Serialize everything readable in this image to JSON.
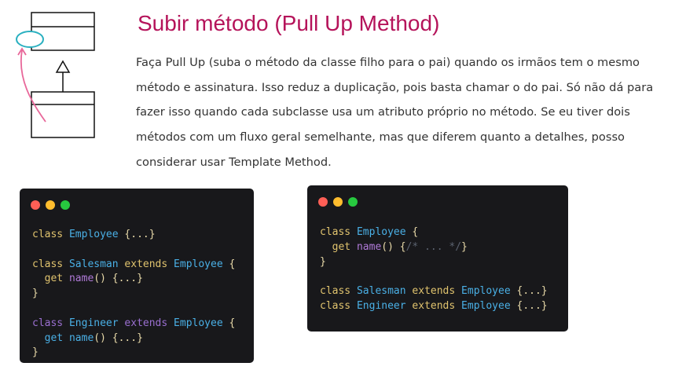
{
  "title": "Subir método (Pull Up Method)",
  "description": "Faça Pull Up (suba o método da classe filho para o pai) quando os irmãos tem o mesmo método e assinatura.  Isso reduz a duplicação, pois basta chamar o do pai. Só não dá para fazer isso quando cada subclasse usa um atributo próprio no método. Se eu tiver dois métodos com um fluxo geral semelhante, mas que diferem quanto a detalhes, posso considerar usar Template Method.",
  "colors": {
    "title": "#b5135a",
    "dot_red": "#ff5f56",
    "dot_yellow": "#ffbd2e",
    "dot_green": "#27c93f",
    "oval": "#2ab0c0",
    "arrow": "#e8689a"
  },
  "before_code": [
    [
      [
        "kw",
        "class "
      ],
      [
        "ty",
        "Employee "
      ],
      [
        "pu",
        "{...}"
      ]
    ],
    [],
    [
      [
        "kw",
        "class "
      ],
      [
        "ty",
        "Salesman "
      ],
      [
        "kw",
        "extends "
      ],
      [
        "ty",
        "Employee "
      ],
      [
        "pu",
        "{"
      ]
    ],
    [
      [
        "kw",
        "  get "
      ],
      [
        "fn",
        "name"
      ],
      [
        "pu",
        "() {...}"
      ]
    ],
    [
      [
        "pu",
        "}"
      ]
    ],
    [],
    [
      [
        "rm",
        "class "
      ],
      [
        "ty",
        "Engineer "
      ],
      [
        "rm",
        "extends "
      ],
      [
        "ty",
        "Employee "
      ],
      [
        "pu",
        "{"
      ]
    ],
    [
      [
        "bl",
        "  get "
      ],
      [
        "bl",
        "name"
      ],
      [
        "pu",
        "() {...}"
      ]
    ],
    [
      [
        "pu",
        "}"
      ]
    ]
  ],
  "after_code": [
    [
      [
        "kw",
        "class "
      ],
      [
        "ty",
        "Employee "
      ],
      [
        "pu",
        "{"
      ]
    ],
    [
      [
        "kw",
        "  get "
      ],
      [
        "fn",
        "name"
      ],
      [
        "pu",
        "() {"
      ],
      [
        "cm",
        "/* ... */"
      ],
      [
        "pu",
        "}"
      ]
    ],
    [
      [
        "pu",
        "}"
      ]
    ],
    [],
    [
      [
        "kw",
        "class "
      ],
      [
        "ty",
        "Salesman "
      ],
      [
        "kw",
        "extends "
      ],
      [
        "ty",
        "Employee "
      ],
      [
        "pu",
        "{...}"
      ]
    ],
    [
      [
        "kw",
        "class "
      ],
      [
        "ty",
        "Engineer "
      ],
      [
        "kw",
        "extends "
      ],
      [
        "ty",
        "Employee "
      ],
      [
        "pu",
        "{...}"
      ]
    ]
  ]
}
